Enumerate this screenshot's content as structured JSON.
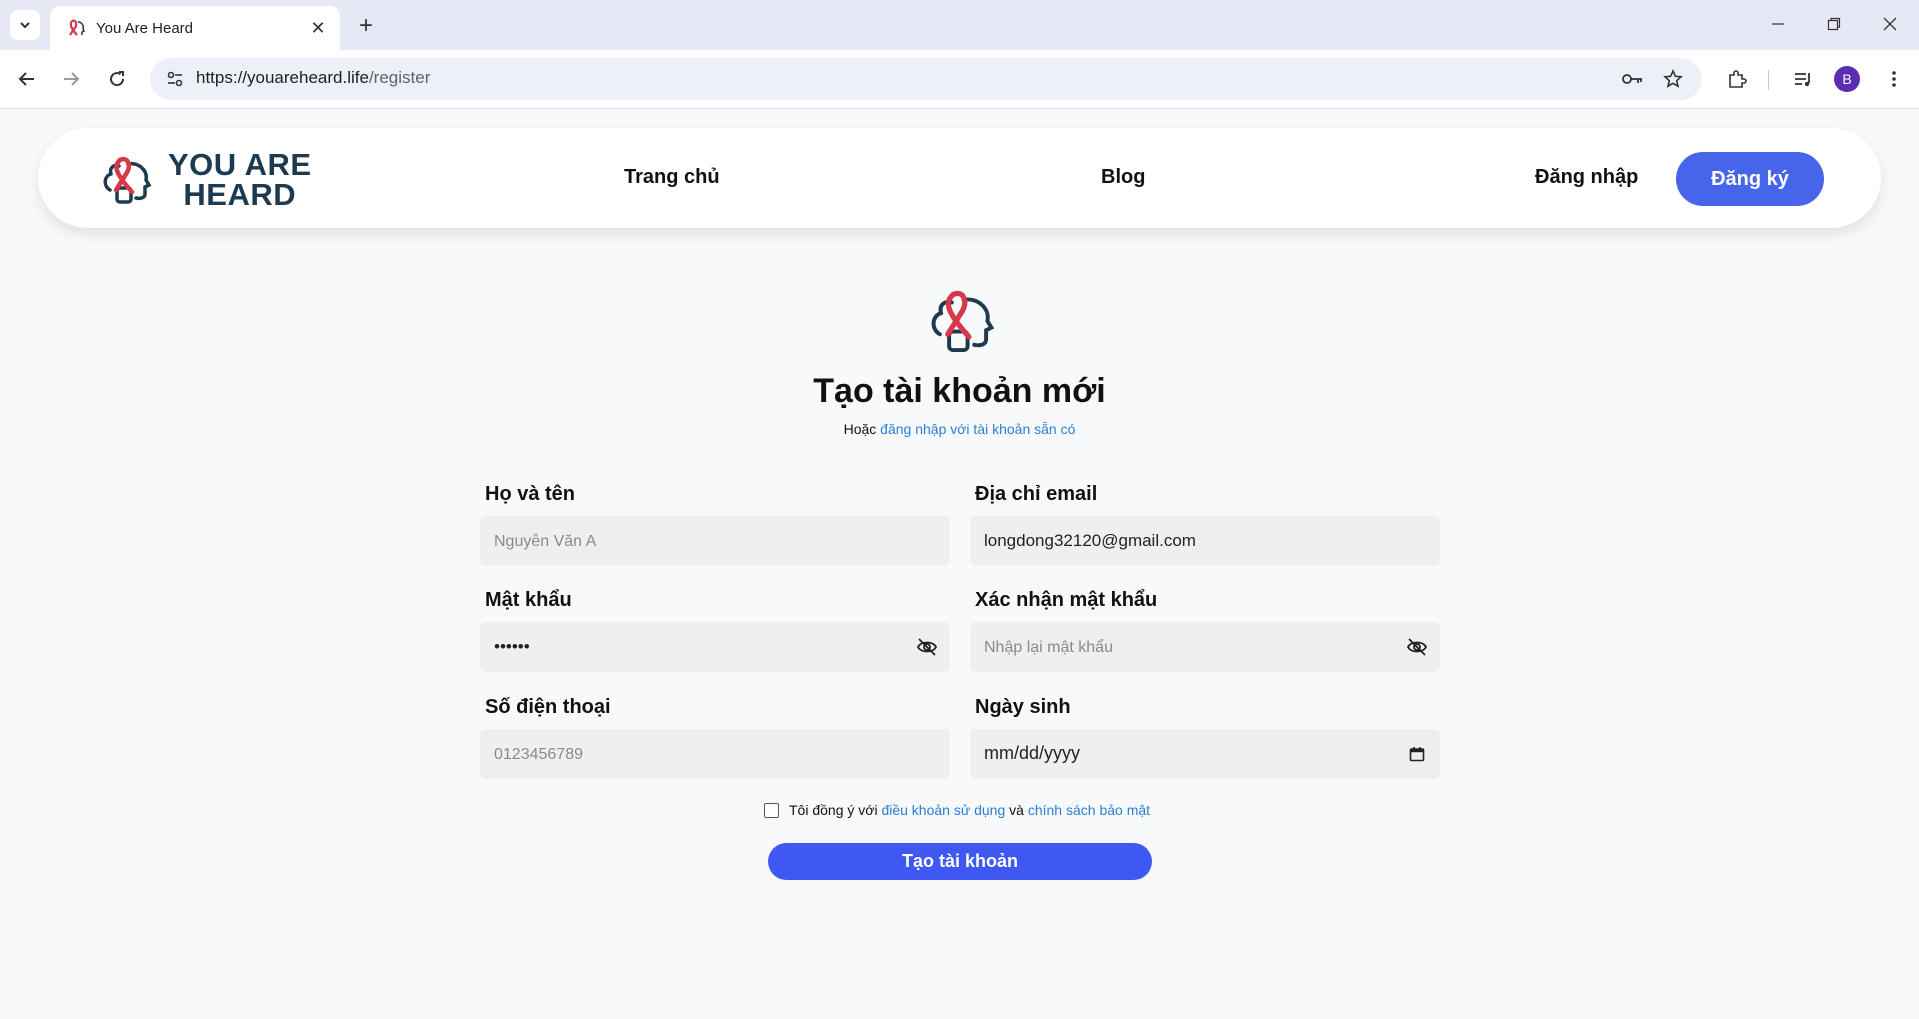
{
  "browser": {
    "tab_title": "You Are Heard",
    "url_host": "https://youareheard.life",
    "url_path": "/register",
    "profile_initial": "B"
  },
  "header": {
    "brand_line1": "YOU ARE",
    "brand_line2": "HEARD",
    "nav": [
      "Trang chủ",
      "Blog"
    ],
    "login_label": "Đăng nhập",
    "signup_label": "Đăng ký"
  },
  "form": {
    "title": "Tạo tài khoản mới",
    "subtitle_prefix": "Hoặc",
    "subtitle_link": "đăng nhập với tài khoản sẵn có",
    "fullname_label": "Họ và tên",
    "fullname_placeholder": "Nguyễn Văn A",
    "email_label": "Địa chỉ email",
    "email_value": "longdong32120@gmail.com",
    "password_label": "Mật khẩu",
    "password_value": "123456",
    "confirm_label": "Xác nhận mật khẩu",
    "confirm_placeholder": "Nhập lại mật khẩu",
    "phone_label": "Số điện thoại",
    "phone_placeholder": "0123456789",
    "dob_label": "Ngày sinh",
    "dob_value": "mm/dd/yyyy",
    "terms_prefix": "Tôi đồng ý với",
    "terms_link": "điều khoản sử dụng",
    "terms_and": "và",
    "privacy_link": "chính sách bảo mật",
    "submit_label": "Tạo tài khoản"
  },
  "colors": {
    "primary": "#4765ea",
    "link": "#2a7fd4",
    "brand_red": "#d8394a",
    "brand_navy": "#1e3a4f"
  }
}
